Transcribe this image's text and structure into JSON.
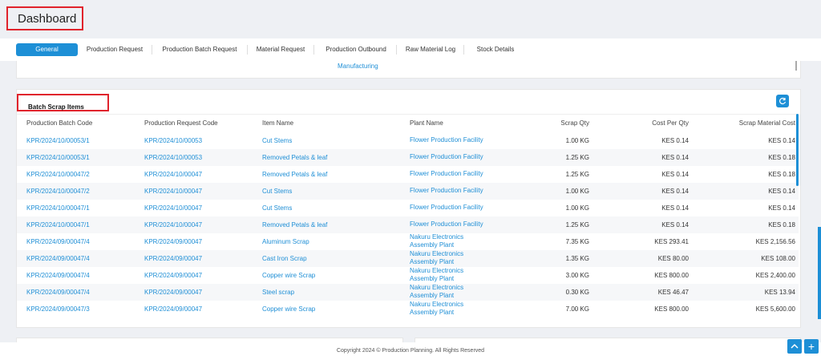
{
  "header": {
    "title": "Dashboard"
  },
  "tabs": [
    "General",
    "Production Request",
    "Production Batch Request",
    "Material Request",
    "Production Outbound",
    "Raw Material Log",
    "Stock Details"
  ],
  "top_panel": {
    "fragment": "Manufacturing"
  },
  "batch_scrap": {
    "title": "Batch Scrap Items",
    "columns": [
      "Production Batch Code",
      "Production Request Code",
      "Item Name",
      "Plant Name",
      "Scrap Qty",
      "Cost Per Qty",
      "Scrap Material Cost"
    ],
    "rows": [
      {
        "batch": "KPR/2024/10/00053/1",
        "request": "KPR/2024/10/00053",
        "item": "Cut Stems",
        "plant_l1": "Flower Production Facility",
        "plant_l2": "",
        "qty": "1.00 KG",
        "cost": "KES 0.14",
        "total": "KES 0.14"
      },
      {
        "batch": "KPR/2024/10/00053/1",
        "request": "KPR/2024/10/00053",
        "item": "Removed Petals & leaf",
        "plant_l1": "Flower Production Facility",
        "plant_l2": "",
        "qty": "1.25 KG",
        "cost": "KES 0.14",
        "total": "KES 0.18"
      },
      {
        "batch": "KPR/2024/10/00047/2",
        "request": "KPR/2024/10/00047",
        "item": "Removed Petals & leaf",
        "plant_l1": "Flower Production Facility",
        "plant_l2": "",
        "qty": "1.25 KG",
        "cost": "KES 0.14",
        "total": "KES 0.18"
      },
      {
        "batch": "KPR/2024/10/00047/2",
        "request": "KPR/2024/10/00047",
        "item": "Cut Stems",
        "plant_l1": "Flower Production Facility",
        "plant_l2": "",
        "qty": "1.00 KG",
        "cost": "KES 0.14",
        "total": "KES 0.14"
      },
      {
        "batch": "KPR/2024/10/00047/1",
        "request": "KPR/2024/10/00047",
        "item": "Cut Stems",
        "plant_l1": "Flower Production Facility",
        "plant_l2": "",
        "qty": "1.00 KG",
        "cost": "KES 0.14",
        "total": "KES 0.14"
      },
      {
        "batch": "KPR/2024/10/00047/1",
        "request": "KPR/2024/10/00047",
        "item": "Removed Petals & leaf",
        "plant_l1": "Flower Production Facility",
        "plant_l2": "",
        "qty": "1.25 KG",
        "cost": "KES 0.14",
        "total": "KES 0.18"
      },
      {
        "batch": "KPR/2024/09/00047/4",
        "request": "KPR/2024/09/00047",
        "item": "Aluminum Scrap",
        "plant_l1": "Nakuru Electronics",
        "plant_l2": "Assembly Plant",
        "qty": "7.35 KG",
        "cost": "KES 293.41",
        "total": "KES 2,156.56"
      },
      {
        "batch": "KPR/2024/09/00047/4",
        "request": "KPR/2024/09/00047",
        "item": "Cast Iron Scrap",
        "plant_l1": "Nakuru Electronics",
        "plant_l2": "Assembly Plant",
        "qty": "1.35 KG",
        "cost": "KES 80.00",
        "total": "KES 108.00"
      },
      {
        "batch": "KPR/2024/09/00047/4",
        "request": "KPR/2024/09/00047",
        "item": "Copper wire Scrap",
        "plant_l1": "Nakuru Electronics",
        "plant_l2": "Assembly Plant",
        "qty": "3.00 KG",
        "cost": "KES 800.00",
        "total": "KES 2,400.00"
      },
      {
        "batch": "KPR/2024/09/00047/4",
        "request": "KPR/2024/09/00047",
        "item": "Steel scrap",
        "plant_l1": "Nakuru Electronics",
        "plant_l2": "Assembly Plant",
        "qty": "0.30 KG",
        "cost": "KES 46.47",
        "total": "KES 13.94"
      },
      {
        "batch": "KPR/2024/09/00047/3",
        "request": "KPR/2024/09/00047",
        "item": "Copper wire Scrap",
        "plant_l1": "Nakuru Electronics",
        "plant_l2": "Assembly Plant",
        "qty": "7.00 KG",
        "cost": "KES 800.00",
        "total": "KES 5,600.00"
      }
    ]
  },
  "footer": {
    "text": "Copyright 2024 © Production Planning. All Rights Reserved"
  },
  "colors": {
    "accent": "#1d8fd6",
    "highlight": "#e0232c",
    "link": "#1f8fd6"
  },
  "icons": {
    "refresh": "refresh-icon",
    "scroll_top": "chevron-up-icon",
    "add": "plus-icon"
  }
}
